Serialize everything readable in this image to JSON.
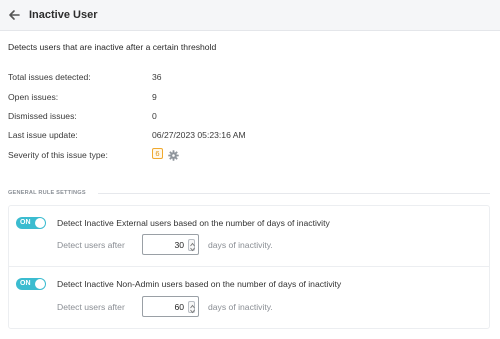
{
  "header": {
    "title": "Inactive User",
    "back_icon": "back-arrow-icon"
  },
  "description": "Detects users that are inactive after a certain threshold",
  "stats": [
    {
      "label": "Total issues detected:",
      "value": "36"
    },
    {
      "label": "Open issues:",
      "value": "9"
    },
    {
      "label": "Dismissed issues:",
      "value": "0"
    },
    {
      "label": "Last issue update:",
      "value": "06/27/2023 05:23:16 AM"
    }
  ],
  "severity": {
    "label": "Severity of this issue type:",
    "value": "6",
    "badge_color": "#f0a92e",
    "settings_icon": "gear-icon"
  },
  "general_rules": {
    "section_title": "GENERAL RULE SETTINGS",
    "toggle_color": "#3bbcd0",
    "rules": [
      {
        "enabled": true,
        "toggle_label": "ON",
        "title": "Detect Inactive External users based on the number of days of inactivity",
        "prefix": "Detect users after",
        "value": "30",
        "suffix": "days of inactivity."
      },
      {
        "enabled": true,
        "toggle_label": "ON",
        "title": "Detect Inactive Non-Admin users based on the number of days of inactivity",
        "prefix": "Detect users after",
        "value": "60",
        "suffix": "days of inactivity."
      }
    ]
  }
}
